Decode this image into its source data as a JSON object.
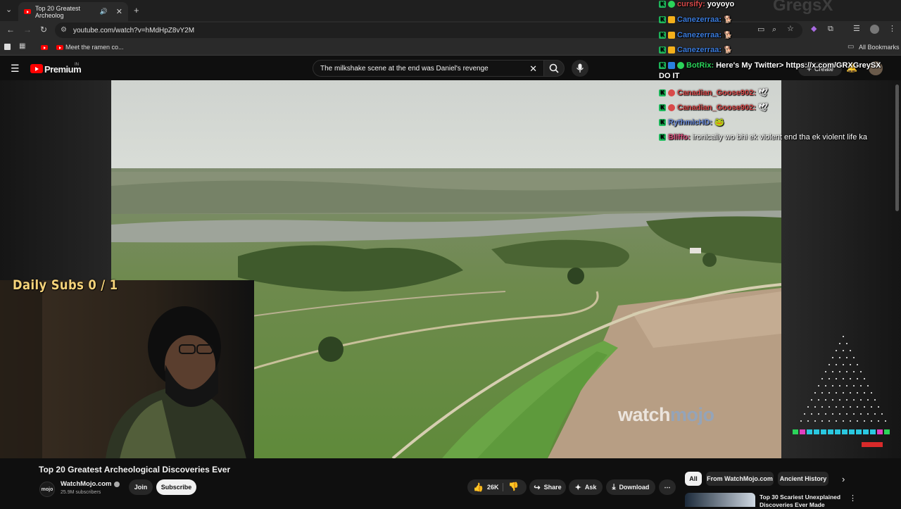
{
  "browser": {
    "tab_title": "Top 20 Greatest Archeolog",
    "url": "youtube.com/watch?v=hMdHpZ8vY2M",
    "bookmark_1": "Meet the ramen co...",
    "all_bookmarks": "All Bookmarks"
  },
  "youtube": {
    "logo": "Premium",
    "region": "IN",
    "search_query": "The milkshake scene at the end was Daniel's revenge",
    "create_label": "Create"
  },
  "video": {
    "title": "Top 20 Greatest Archeological Discoveries Ever",
    "watermark_1": "watch",
    "watermark_2": "mojo",
    "channel_name": "WatchMojo.com",
    "channel_logo": "mojo",
    "subscribers": "25.9M subscribers",
    "join_label": "Join",
    "subscribe_label": "Subscribe",
    "likes": "26K",
    "share_label": "Share",
    "ask_label": "Ask",
    "download_label": "Download"
  },
  "overlay": {
    "daily_subs": "Daily Subs  0 / 1",
    "stream_logo": "GregsX"
  },
  "chat": [
    {
      "user": "cursify:",
      "msg": "yoyoyo",
      "color": "#d94a4a"
    },
    {
      "user": "Canezerraa:",
      "msg": "",
      "color": "#3a7bdc"
    },
    {
      "user": "Canezerraa:",
      "msg": "",
      "color": "#3a7bdc"
    },
    {
      "user": "Canezerraa:",
      "msg": "",
      "color": "#3a7bdc"
    },
    {
      "user": "BotRix:",
      "msg": "Here's My Twitter> https://x.com/GRXGreySX",
      "color": "#2bd45a"
    },
    {
      "user": "",
      "msg": "DO IT",
      "color": "#ffffff"
    },
    {
      "user": "Canadian_Goose902:",
      "msg": "",
      "color": "#d94a4a"
    },
    {
      "user": "Canadian_Goose902:",
      "msg": "",
      "color": "#d94a4a"
    },
    {
      "user": "RythmicHD:",
      "msg": "",
      "color": "#6a8ad8"
    },
    {
      "user": "Bliffo:",
      "msg": "ironically wo bhi ek violent end tha ek violent life ka",
      "color": "#d94a7a"
    }
  ],
  "chips": [
    "All",
    "From WatchMojo.com",
    "Ancient History"
  ],
  "recommended": {
    "title_line1": "Top 30 Scariest Unexplained",
    "title_line2": "Discoveries Ever Made"
  },
  "colors": {
    "accent": "#ff0000",
    "subs_text": "#f6d37a",
    "background": "#0f0f0f"
  }
}
